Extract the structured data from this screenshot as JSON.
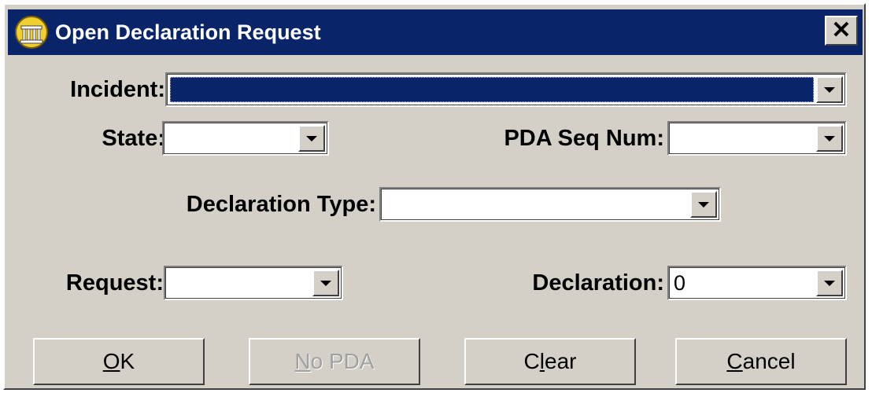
{
  "window": {
    "title": "Open Declaration Request",
    "close_glyph": "✕",
    "icon": "building-icon",
    "title_color": "#0a246a"
  },
  "fields": {
    "incident": {
      "label": "Incident:",
      "value": ""
    },
    "state": {
      "label": "State:",
      "value": ""
    },
    "pda_seq_num": {
      "label": "PDA Seq Num:",
      "value": ""
    },
    "declaration_type": {
      "label": "Declaration Type:",
      "value": ""
    },
    "request": {
      "label": "Request:",
      "value": ""
    },
    "declaration": {
      "label": "Declaration:",
      "value": "0"
    }
  },
  "buttons": {
    "ok": {
      "mnemonic": "O",
      "rest": "K"
    },
    "no_pda": {
      "mnemonic": "N",
      "rest": "o PDA",
      "disabled": true
    },
    "clear": {
      "pre": "C",
      "mnemonic": "l",
      "rest": "ear"
    },
    "cancel": {
      "mnemonic": "C",
      "rest": "ancel"
    }
  }
}
